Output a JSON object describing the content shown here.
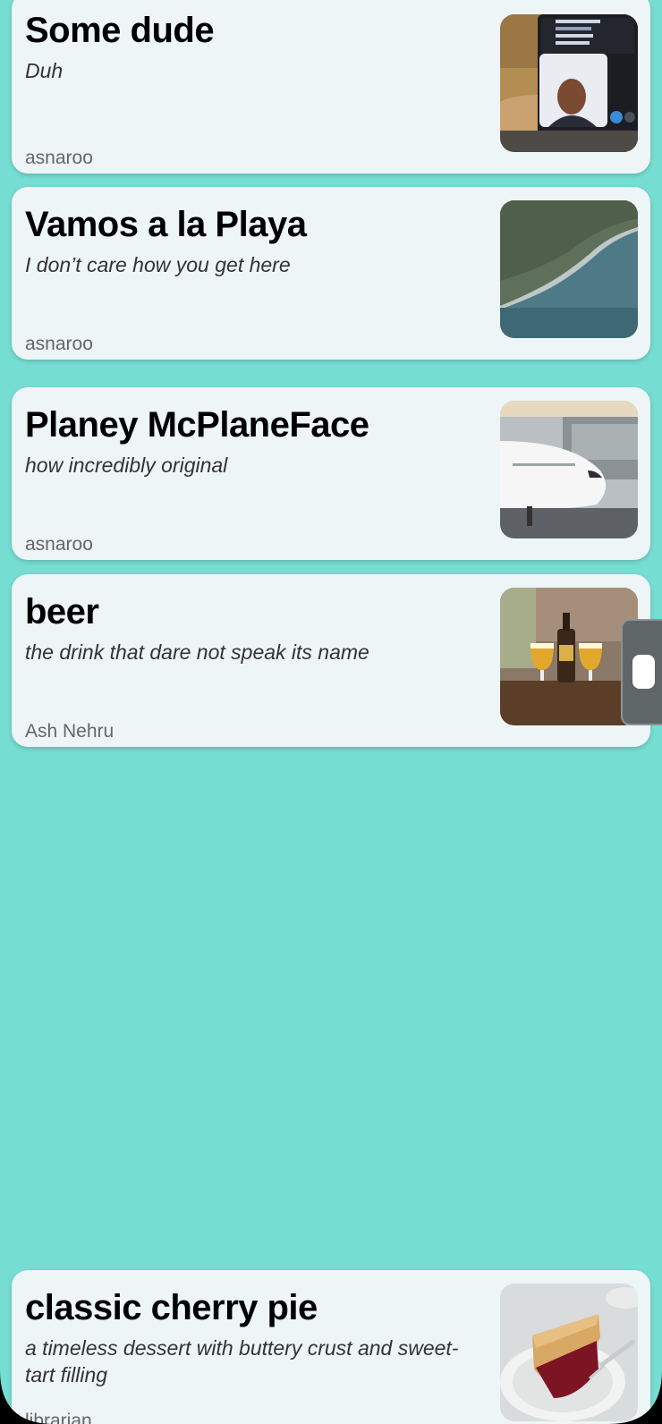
{
  "posts": [
    {
      "title": "Some dude",
      "subtitle": "Duh",
      "author": "asnaroo",
      "image_icon": "video-call-photo-icon"
    },
    {
      "title": "Vamos a la Playa",
      "subtitle": "I don’t care how you get here",
      "author": "asnaroo",
      "image_icon": "coastline-photo-icon"
    },
    {
      "title": "Planey McPlaneFace",
      "subtitle": "how incredibly original",
      "author": "asnaroo",
      "image_icon": "airplane-photo-icon"
    },
    {
      "title": "beer",
      "subtitle": "the drink that dare not speak its name",
      "author": "Ash Nehru",
      "image_icon": "beer-photo-icon"
    },
    {
      "title": "classic cherry pie",
      "subtitle": "a timeless dessert with buttery crust and sweet-tart filling",
      "author": "librarian",
      "image_icon": "cherry-pie-photo-icon"
    }
  ],
  "colors": {
    "background": "#76ddd3",
    "card": "#eef5f6",
    "title": "#000000",
    "subtitle": "#333333",
    "author": "#666666"
  }
}
